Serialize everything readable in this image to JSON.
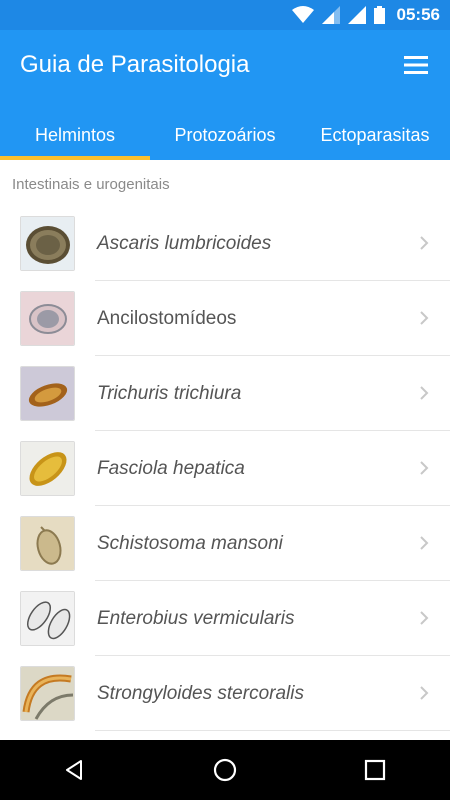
{
  "status_bar": {
    "time": "05:56",
    "icons": [
      "wifi-icon",
      "signal-icon",
      "signal-icon",
      "battery-icon"
    ]
  },
  "app": {
    "title": "Guia de Parasitologia",
    "menu_icon": "hamburger-menu-icon"
  },
  "tabs": [
    {
      "label": "Helmintos",
      "active": true
    },
    {
      "label": "Protozoários",
      "active": false
    },
    {
      "label": "Ectoparasitas",
      "active": false
    }
  ],
  "section": {
    "header": "Intestinais e urogenitais"
  },
  "items": [
    {
      "label": "Ascaris lumbricoides",
      "italic": true
    },
    {
      "label": "Ancilostomídeos",
      "italic": false
    },
    {
      "label": "Trichuris trichiura",
      "italic": true
    },
    {
      "label": "Fasciola hepatica",
      "italic": true
    },
    {
      "label": "Schistosoma mansoni",
      "italic": true
    },
    {
      "label": "Enterobius vermicularis",
      "italic": true
    },
    {
      "label": "Strongyloides stercoralis",
      "italic": true
    }
  ],
  "nav_bar": {
    "icons": [
      "back-icon",
      "home-icon",
      "recents-icon"
    ]
  },
  "colors": {
    "primary": "#2196f3",
    "status_bar": "#1e88e5",
    "tab_indicator": "#fbc02d"
  }
}
